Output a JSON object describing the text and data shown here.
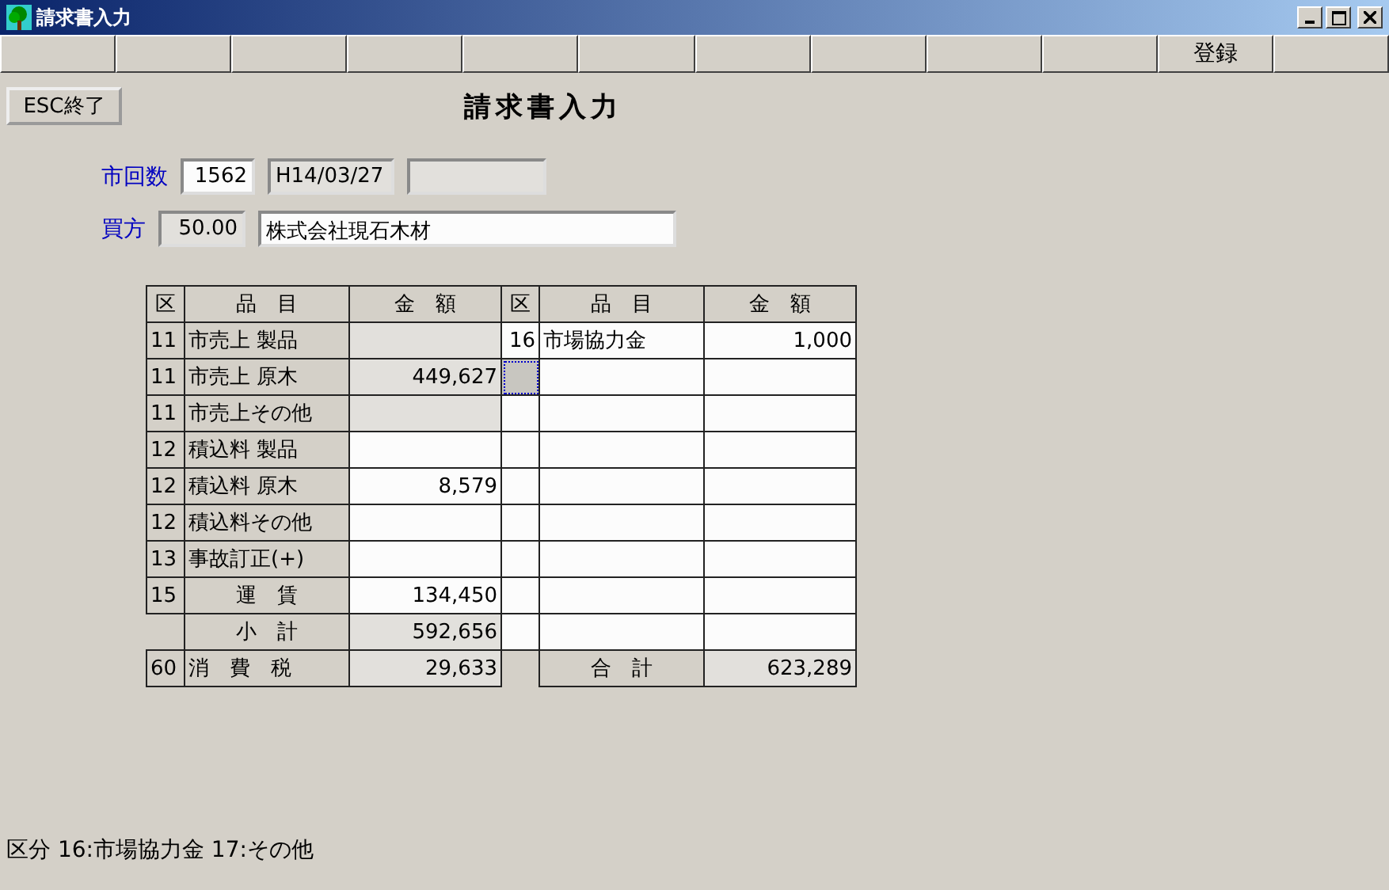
{
  "window": {
    "title": "請求書入力"
  },
  "function_keys": [
    {
      "label": "登録"
    }
  ],
  "exit_button": {
    "label": "ESC終了"
  },
  "heading": "請求書入力",
  "form": [
    {
      "label": "市回数",
      "fields": [
        {
          "value": "1562",
          "readonly": false,
          "kind": "number"
        },
        {
          "value": "H14/03/27",
          "readonly": true,
          "kind": "date"
        },
        {
          "readonly": true,
          "kind": "date"
        }
      ]
    },
    {
      "label": "買方",
      "fields": [
        {
          "value": "50.00",
          "readonly": true,
          "kind": "number"
        },
        {
          "value": "株式会社現石木材",
          "readonly": false,
          "kind": "name"
        }
      ]
    }
  ],
  "left_table": {
    "columns": [
      "区",
      "品　目",
      "金　額"
    ],
    "rows": [
      {
        "code": "11",
        "item": "市売上 製品",
        "locked": true,
        "centered": false
      },
      {
        "code": "11",
        "item": "市売上 原木",
        "amount": "449,627",
        "locked": true,
        "centered": false
      },
      {
        "code": "11",
        "item": "市売上その他",
        "locked": true,
        "centered": false
      },
      {
        "code": "12",
        "item": "積込料 製品",
        "locked": false,
        "centered": false
      },
      {
        "code": "12",
        "item": "積込料 原木",
        "amount": "8,579",
        "locked": false,
        "centered": false
      },
      {
        "code": "12",
        "item": "積込料その他",
        "locked": false,
        "centered": false
      },
      {
        "code": "13",
        "item": "事故訂正(+)",
        "locked": false,
        "centered": false
      },
      {
        "code": "15",
        "item": "運　賃",
        "amount": "134,450",
        "locked": false,
        "centered": true
      }
    ],
    "subtotal": {
      "label": "小　計",
      "amount": "592,656"
    },
    "tax": {
      "code": "60",
      "label": "消　費　税",
      "amount": "29,633"
    }
  },
  "right_table": {
    "columns": [
      "区",
      "品　目",
      "金　額"
    ],
    "rows": [
      {
        "code": "16",
        "item": "市場協力金",
        "amount": "1,000",
        "focused": false
      },
      {
        "focused": true
      },
      {
        "focused": false
      },
      {
        "focused": false
      },
      {
        "focused": false
      },
      {
        "focused": false
      },
      {
        "focused": false
      },
      {
        "focused": false
      },
      {
        "focused": false
      }
    ],
    "total": {
      "label": "合　計",
      "amount": "623,289"
    }
  },
  "status_text": "区分 16:市場協力金 17:その他"
}
